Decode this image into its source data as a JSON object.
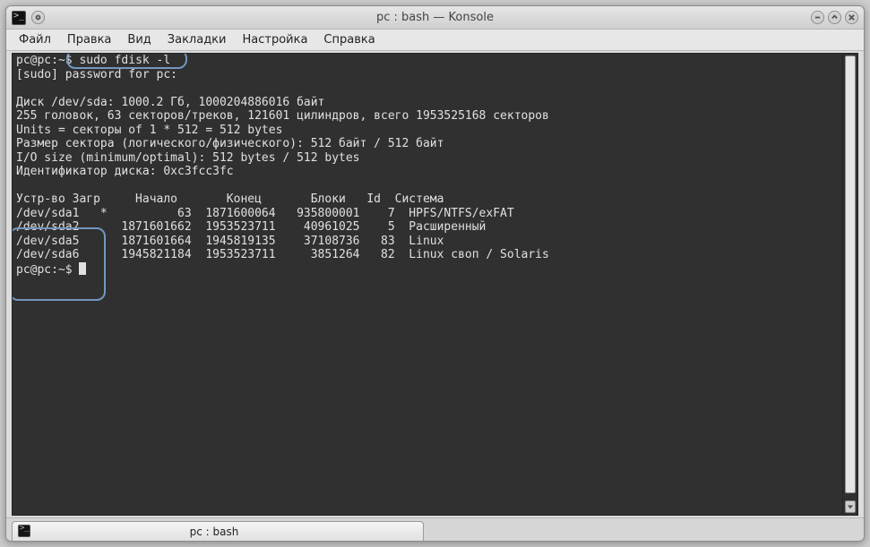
{
  "window": {
    "title": "pc : bash — Konsole"
  },
  "menu": {
    "items": [
      "Файл",
      "Правка",
      "Вид",
      "Закладки",
      "Настройка",
      "Справка"
    ]
  },
  "terminal": {
    "prompt1": "pc@pc:~$ ",
    "cmd1": "sudo fdisk -l",
    "sudo_line": "[sudo] password for pc:",
    "disk_line": "Диск /dev/sda: 1000.2 Гб, 1000204886016 байт",
    "heads_line": "255 головок, 63 секторов/треков, 121601 цилиндров, всего 1953525168 секторов",
    "units_line": "Units = секторы of 1 * 512 = 512 bytes",
    "sector_line": "Размер сектора (логического/физического): 512 байт / 512 байт",
    "iosize_line": "I/O size (minimum/optimal): 512 bytes / 512 bytes",
    "diskid_line": "Идентификатор диска: 0xc3fcc3fc",
    "table_header": "Устр-во Загр     Начало       Конец       Блоки   Id  Система",
    "rows": [
      "/dev/sda1   *          63  1871600064   935800001    7  HPFS/NTFS/exFAT",
      "/dev/sda2      1871601662  1953523711    40961025    5  Расширенный",
      "/dev/sda5      1871601664  1945819135    37108736   83  Linux",
      "/dev/sda6      1945821184  1953523711     3851264   82  Linux своп / Solaris"
    ],
    "prompt2": "pc@pc:~$ "
  },
  "tab": {
    "label": "pc : bash"
  },
  "chart_data": {
    "type": "table",
    "title": "fdisk -l partition table for /dev/sda",
    "columns": [
      "Устр-во",
      "Загр",
      "Начало",
      "Конец",
      "Блоки",
      "Id",
      "Система"
    ],
    "rows": [
      {
        "device": "/dev/sda1",
        "boot": "*",
        "start": 63,
        "end": 1871600064,
        "blocks": 935800001,
        "id": 7,
        "system": "HPFS/NTFS/exFAT"
      },
      {
        "device": "/dev/sda2",
        "boot": "",
        "start": 1871601662,
        "end": 1953523711,
        "blocks": 40961025,
        "id": 5,
        "system": "Расширенный"
      },
      {
        "device": "/dev/sda5",
        "boot": "",
        "start": 1871601664,
        "end": 1945819135,
        "blocks": 37108736,
        "id": 83,
        "system": "Linux"
      },
      {
        "device": "/dev/sda6",
        "boot": "",
        "start": 1945821184,
        "end": 1953523711,
        "blocks": 3851264,
        "id": 82,
        "system": "Linux своп / Solaris"
      }
    ],
    "disk": {
      "path": "/dev/sda",
      "size_text": "1000.2 Гб",
      "bytes": 1000204886016,
      "heads": 255,
      "sectors_per_track": 63,
      "cylinders": 121601,
      "total_sectors": 1953525168,
      "sector_size_bytes": 512,
      "identifier": "0xc3fcc3fc"
    }
  }
}
